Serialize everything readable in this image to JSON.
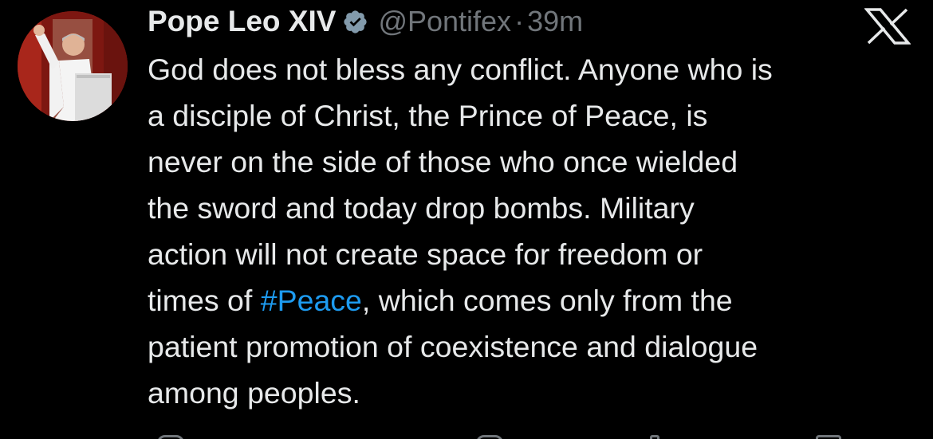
{
  "tweet": {
    "author": {
      "display_name": "Pope Leo XIV",
      "handle": "@Pontifex",
      "verified": true,
      "verified_color": "#829aab",
      "avatar_icon": "user-avatar"
    },
    "separator": "·",
    "time": "39m",
    "platform_icon": "x-logo-icon",
    "body_lines": [
      {
        "pre": "God does not bless any conflict. Anyone who is",
        "tag": "",
        "post": ""
      },
      {
        "pre": "a disciple of Christ, the Prince of Peace, is",
        "tag": "",
        "post": ""
      },
      {
        "pre": "never on the side of those who once wielded",
        "tag": "",
        "post": ""
      },
      {
        "pre": "the sword and today drop bombs. Military",
        "tag": "",
        "post": ""
      },
      {
        "pre": "action will not create space for freedom or",
        "tag": "",
        "post": ""
      },
      {
        "pre": "times of ",
        "tag": "#Peace",
        "post": ", which comes only from the"
      },
      {
        "pre": "patient promotion of coexistence and dialogue",
        "tag": "",
        "post": ""
      },
      {
        "pre": "among peoples.",
        "tag": "",
        "post": ""
      }
    ],
    "colors": {
      "background": "#000000",
      "text": "#e7e9ea",
      "muted": "#71767b",
      "link": "#1d9bf0"
    }
  }
}
